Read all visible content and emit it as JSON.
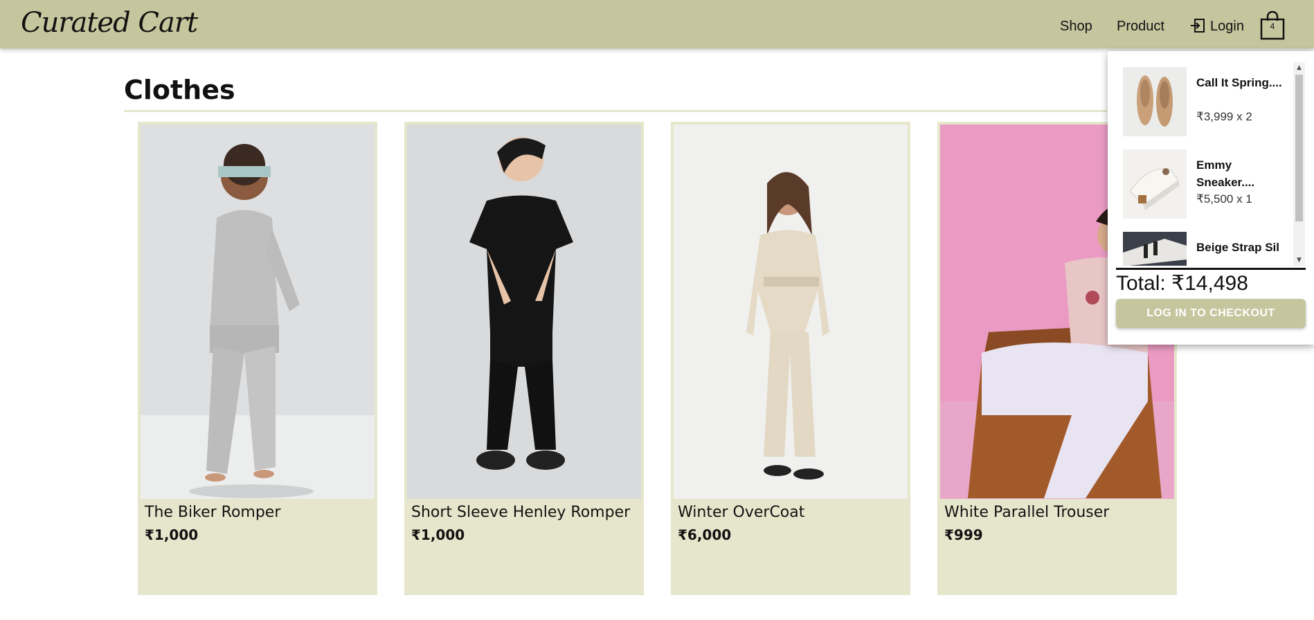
{
  "brand": {
    "name": "Curated Cart"
  },
  "nav": {
    "shop": "Shop",
    "product": "Product",
    "login": "Login",
    "cart_count": "4"
  },
  "section": {
    "title": "Clothes"
  },
  "products": [
    {
      "name": "The Biker Romper",
      "price": "₹1,000"
    },
    {
      "name": "Short Sleeve Henley Romper",
      "price": "₹1,000"
    },
    {
      "name": "Winter OverCoat",
      "price": "₹6,000"
    },
    {
      "name": "White Parallel Trouser",
      "price": "₹999"
    }
  ],
  "cart": {
    "items": [
      {
        "name": "Call It Spring....",
        "qty": "₹3,999 x 2"
      },
      {
        "name": "Emmy Sneaker....",
        "qty": "₹5,500 x 1"
      },
      {
        "name": "Beige Strap Sil",
        "qty": ""
      }
    ],
    "total": "Total: ₹14,498",
    "checkout_label": "LOG IN TO CHECKOUT"
  },
  "colors": {
    "navbar": "#c5c59e",
    "card": "#e6e6cc",
    "checkout": "#c5c59e"
  }
}
